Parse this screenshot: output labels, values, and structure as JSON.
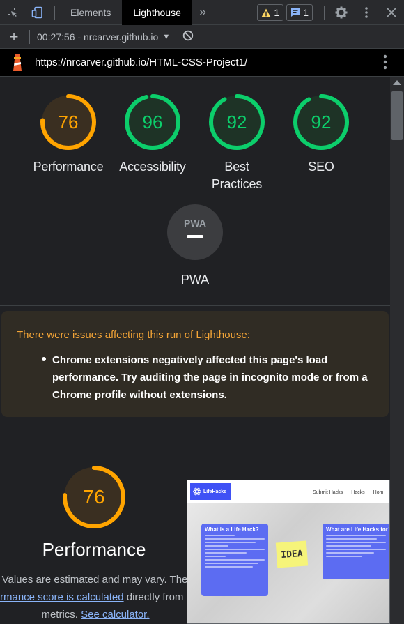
{
  "tabs": {
    "elements": "Elements",
    "lighthouse": "Lighthouse"
  },
  "badges": {
    "warnings": "1",
    "messages": "1"
  },
  "run": {
    "label": "00:27:56 - nrcarver.github.io"
  },
  "url": "https://nrcarver.github.io/HTML-CSS-Project1/",
  "scores": [
    {
      "value": "76",
      "label": "Performance",
      "color": "#ffa400"
    },
    {
      "value": "96",
      "label": "Accessibility",
      "color": "#0cce6b"
    },
    {
      "value": "92",
      "label_line1": "Best",
      "label_line2": "Practices",
      "color": "#0cce6b"
    },
    {
      "value": "92",
      "label": "SEO",
      "color": "#0cce6b"
    }
  ],
  "pwa": {
    "badge": "PWA",
    "label": "PWA"
  },
  "warning": {
    "title": "There were issues affecting this run of Lighthouse:",
    "item": "Chrome extensions negatively affected this page's load performance. Try auditing the page in incognito mode or from a Chrome profile without extensions."
  },
  "performance": {
    "score": "76",
    "title": "Performance",
    "desc_line1": "Values are estimated and may vary. The",
    "desc_link1": "rmance score is calculated",
    "desc_line2_rest": " directly from t",
    "desc_line3_pre": "metrics. ",
    "desc_link2": "See calculator."
  },
  "thumbnail": {
    "brand": "LifeHacks",
    "nav": [
      "Submit Hacks",
      "Hacks",
      "Hom"
    ],
    "card1_title": "What is a Life Hack?",
    "card2_title": "What are Life Hacks for?",
    "sticky": "IDEA"
  },
  "colors": {
    "good": "#0cce6b",
    "average": "#ffa400",
    "warning_text": "#f4a537"
  }
}
